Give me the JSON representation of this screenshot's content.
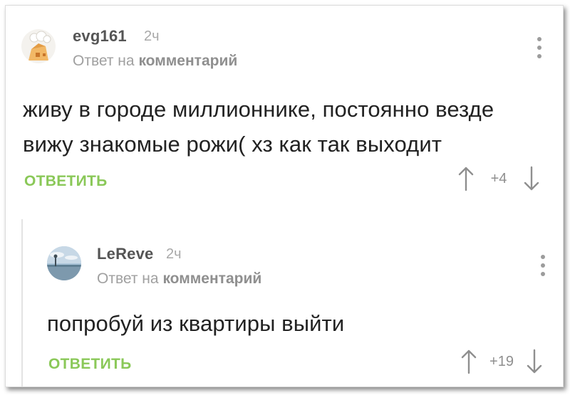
{
  "comments": [
    {
      "author": "evg161",
      "time": "2ч",
      "reply_prefix": "Ответ на",
      "reply_target": "комментарий",
      "text_lines": [
        "живу в городе миллионнике, постоянно везде",
        "вижу знакомые рожи( хз как так выходит"
      ],
      "reply_label": "ОТВЕТИТЬ",
      "score": "+4"
    },
    {
      "author": "LeReve",
      "time": "2ч",
      "reply_prefix": "Ответ на",
      "reply_target": "комментарий",
      "text_lines": [
        "попробуй из квартиры выйти"
      ],
      "reply_label": "ОТВЕТИТЬ",
      "score": "+19"
    }
  ],
  "colors": {
    "accent": "#8ac858",
    "author": "#555555",
    "meta": "#a0a0a0",
    "text": "#222222"
  },
  "icons": {
    "upvote": "arrow-up-icon",
    "downvote": "arrow-down-icon",
    "more": "more-vertical-icon"
  }
}
